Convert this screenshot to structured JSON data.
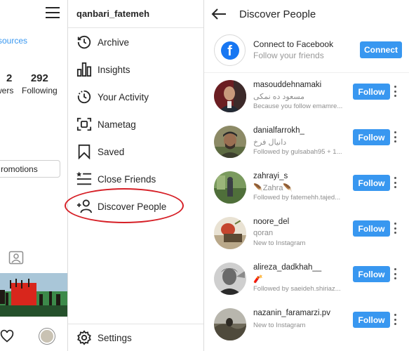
{
  "profile": {
    "sources_link": "sources",
    "followers_count": "2",
    "followers_label": "wers",
    "following_count": "292",
    "following_label": "Following",
    "promotions_label": "romotions"
  },
  "drawer": {
    "username": "qanbari_fatemeh",
    "items": [
      {
        "label": "Archive",
        "icon": "archive-clock-icon"
      },
      {
        "label": "Insights",
        "icon": "bar-chart-icon"
      },
      {
        "label": "Your Activity",
        "icon": "activity-clock-icon"
      },
      {
        "label": "Nametag",
        "icon": "nametag-scan-icon"
      },
      {
        "label": "Saved",
        "icon": "bookmark-icon"
      },
      {
        "label": "Close Friends",
        "icon": "list-star-icon"
      },
      {
        "label": "Discover People",
        "icon": "add-person-icon"
      }
    ],
    "settings_label": "Settings"
  },
  "discover": {
    "title": "Discover People",
    "facebook": {
      "title": "Connect to Facebook",
      "subtitle": "Follow your friends",
      "button": "Connect"
    },
    "suggestions": [
      {
        "username": "masouddehnamaki",
        "fullname": "مسعود ده نمکی",
        "reason": "Because you follow emamre...",
        "button": "Follow"
      },
      {
        "username": "danialfarrokh_",
        "fullname": "دانیال فرخ",
        "reason": "Followed by gulsabah95 + 1...",
        "button": "Follow"
      },
      {
        "username": "zahrayi_s",
        "fullname": "🪶Zahra🪶",
        "reason": "Followed by fatemehh.tajed...",
        "button": "Follow"
      },
      {
        "username": "noore_del",
        "fullname": "qoran",
        "reason": "New to Instagram",
        "button": "Follow"
      },
      {
        "username": "alireza_dadkhah__",
        "fullname": "🧨",
        "reason": "Followed by saeideh.shiriaz...",
        "button": "Follow"
      },
      {
        "username": "nazanin_faramarzi.pv",
        "fullname": "",
        "reason": "New to Instagram",
        "button": "Follow"
      }
    ]
  },
  "colors": {
    "accent_blue": "#3897f0",
    "facebook_blue": "#1877f2",
    "highlight_red": "#d61f26"
  }
}
